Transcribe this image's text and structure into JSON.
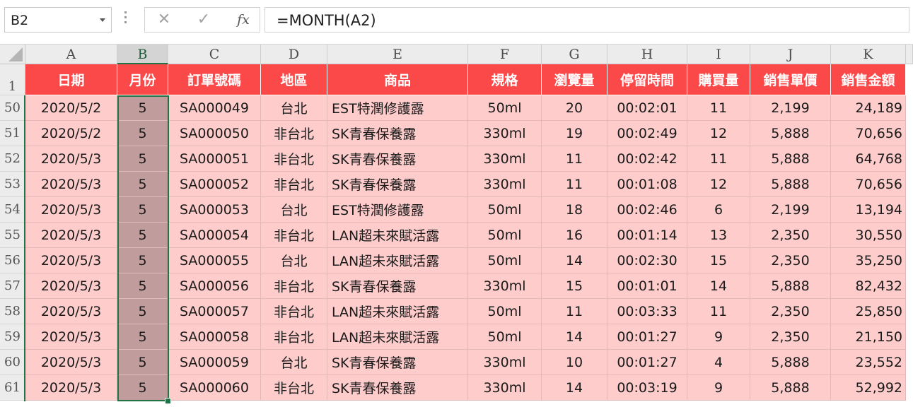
{
  "formula_bar": {
    "name_box": "B2",
    "cancel_icon": "✕",
    "enter_icon": "✓",
    "fx_label": "fx",
    "formula": "=MONTH(A2)"
  },
  "columns": [
    "A",
    "B",
    "C",
    "D",
    "E",
    "F",
    "G",
    "H",
    "I",
    "J",
    "K"
  ],
  "selected_column": "B",
  "header_row": {
    "row_number": "1",
    "cells": [
      "日期",
      "月份",
      "訂單號碼",
      "地區",
      "商品",
      "規格",
      "瀏覽量",
      "停留時間",
      "購買量",
      "銷售單價",
      "銷售金額"
    ]
  },
  "rows": [
    {
      "num": "50",
      "cells": [
        "2020/5/2",
        "5",
        "SA000049",
        "台北",
        "EST特潤修護露",
        "50ml",
        "20",
        "00:02:01",
        "11",
        "2,199",
        "24,189"
      ]
    },
    {
      "num": "51",
      "cells": [
        "2020/5/2",
        "5",
        "SA000050",
        "非台北",
        "SK青春保養露",
        "330ml",
        "19",
        "00:02:49",
        "12",
        "5,888",
        "70,656"
      ]
    },
    {
      "num": "52",
      "cells": [
        "2020/5/3",
        "5",
        "SA000051",
        "非台北",
        "SK青春保養露",
        "330ml",
        "11",
        "00:02:42",
        "11",
        "5,888",
        "64,768"
      ]
    },
    {
      "num": "53",
      "cells": [
        "2020/5/3",
        "5",
        "SA000052",
        "非台北",
        "SK青春保養露",
        "330ml",
        "11",
        "00:01:08",
        "12",
        "5,888",
        "70,656"
      ]
    },
    {
      "num": "54",
      "cells": [
        "2020/5/3",
        "5",
        "SA000053",
        "台北",
        "EST特潤修護露",
        "50ml",
        "18",
        "00:02:46",
        "6",
        "2,199",
        "13,194"
      ]
    },
    {
      "num": "55",
      "cells": [
        "2020/5/3",
        "5",
        "SA000054",
        "非台北",
        "LAN超未來賦活露",
        "50ml",
        "16",
        "00:01:14",
        "13",
        "2,350",
        "30,550"
      ]
    },
    {
      "num": "56",
      "cells": [
        "2020/5/3",
        "5",
        "SA000055",
        "台北",
        "LAN超未來賦活露",
        "50ml",
        "14",
        "00:02:30",
        "15",
        "2,350",
        "35,250"
      ]
    },
    {
      "num": "57",
      "cells": [
        "2020/5/3",
        "5",
        "SA000056",
        "非台北",
        "SK青春保養露",
        "330ml",
        "15",
        "00:01:01",
        "14",
        "5,888",
        "82,432"
      ]
    },
    {
      "num": "58",
      "cells": [
        "2020/5/3",
        "5",
        "SA000057",
        "非台北",
        "LAN超未來賦活露",
        "50ml",
        "11",
        "00:03:33",
        "11",
        "2,350",
        "25,850"
      ]
    },
    {
      "num": "59",
      "cells": [
        "2020/5/3",
        "5",
        "SA000058",
        "非台北",
        "LAN超未來賦活露",
        "50ml",
        "14",
        "00:01:27",
        "9",
        "2,350",
        "21,150"
      ]
    },
    {
      "num": "60",
      "cells": [
        "2020/5/3",
        "5",
        "SA000059",
        "台北",
        "SK青春保養露",
        "330ml",
        "10",
        "00:01:27",
        "4",
        "5,888",
        "23,552"
      ]
    },
    {
      "num": "61",
      "cells": [
        "2020/5/3",
        "5",
        "SA000060",
        "非台北",
        "SK青春保養露",
        "330ml",
        "14",
        "00:03:19",
        "9",
        "5,888",
        "52,992"
      ]
    }
  ],
  "colors": {
    "header_fill": "#fb4848",
    "data_fill": "#ffcccc",
    "selected_fill": "#c19c9c",
    "selection_border": "#217346"
  }
}
